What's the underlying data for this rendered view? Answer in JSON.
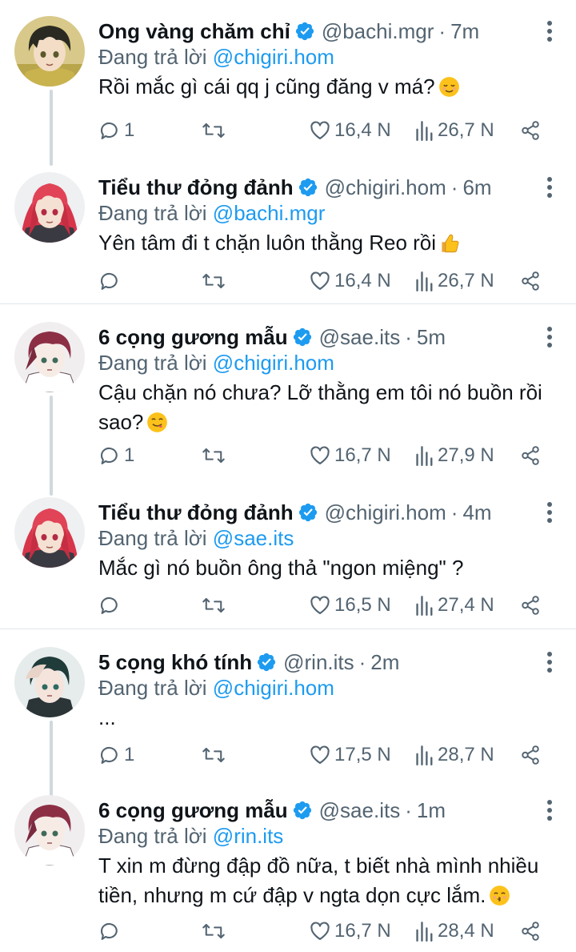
{
  "colors": {
    "accent": "#1d9bf0",
    "text_primary": "#0f1419",
    "text_secondary": "#536471",
    "thread_line": "#cfd9de",
    "divider": "#e1e6ea"
  },
  "replying_prefix": "Đang trả lời",
  "tweets": [
    {
      "name": "Ong vàng chăm chỉ",
      "handle": "@bachi.mgr",
      "time": "7m",
      "reply_to": "@chigiri.hom",
      "text": "Rồi mắc gì cái qq j cũng đăng v má?",
      "emoji": "relieved-face-emoji",
      "replies": "1",
      "retweets": "",
      "likes": "16,4 N",
      "views": "26,7 N",
      "avatar": "avatar-bachira"
    },
    {
      "name": "Tiểu thư đỏng đảnh",
      "handle": "@chigiri.hom",
      "time": "6m",
      "reply_to": "@bachi.mgr",
      "text": "Yên tâm đi t chặn luôn thằng Reo rồi",
      "emoji": "thumbs-up-emoji",
      "replies": "",
      "retweets": "",
      "likes": "16,4 N",
      "views": "26,7 N",
      "avatar": "avatar-chigiri"
    },
    {
      "name": "6 cọng gương mẫu",
      "handle": "@sae.its",
      "time": "5m",
      "reply_to": "@chigiri.hom",
      "text": "Cậu chặn nó chưa? Lỡ thằng em tôi nó buồn rồi sao?",
      "emoji": "savoring-food-face-emoji",
      "replies": "1",
      "retweets": "",
      "likes": "16,7 N",
      "views": "27,9 N",
      "avatar": "avatar-sae"
    },
    {
      "name": "Tiểu thư đỏng đảnh",
      "handle": "@chigiri.hom",
      "time": "4m",
      "reply_to": "@sae.its",
      "text": "Mắc gì nó buồn ông thả \"ngon miệng\" ?",
      "emoji": "",
      "replies": "",
      "retweets": "",
      "likes": "16,5 N",
      "views": "27,4 N",
      "avatar": "avatar-chigiri"
    },
    {
      "name": "5 cọng khó tính",
      "handle": "@rin.its",
      "time": "2m",
      "reply_to": "@chigiri.hom",
      "text": "...",
      "emoji": "",
      "replies": "1",
      "retweets": "",
      "likes": "17,5 N",
      "views": "28,7 N",
      "avatar": "avatar-rin"
    },
    {
      "name": "6 cọng gương mẫu",
      "handle": "@sae.its",
      "time": "1m",
      "reply_to": "@rin.its",
      "text": "T xin m đừng đập đồ nữa, t biết nhà mình nhiều tiền, nhưng m cứ đập v ngta dọn cực lắm.",
      "emoji": "kissing-face-emoji",
      "replies": "",
      "retweets": "",
      "likes": "16,7 N",
      "views": "28,4 N",
      "avatar": "avatar-sae"
    }
  ]
}
